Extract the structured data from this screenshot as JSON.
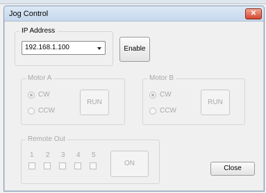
{
  "window": {
    "title": "Jog Control",
    "close_glyph": "✕"
  },
  "ip": {
    "label": "IP Address",
    "value": "192.168.1.100"
  },
  "enable_label": "Enable",
  "motor_a": {
    "label": "Motor A",
    "cw": "CW",
    "ccw": "CCW",
    "run": "RUN"
  },
  "motor_b": {
    "label": "Motor B",
    "cw": "CW",
    "ccw": "CCW",
    "run": "RUN"
  },
  "remote_out": {
    "label": "Remote Out",
    "channels": [
      "1",
      "2",
      "3",
      "4",
      "5"
    ],
    "on": "ON"
  },
  "close_label": "Close"
}
